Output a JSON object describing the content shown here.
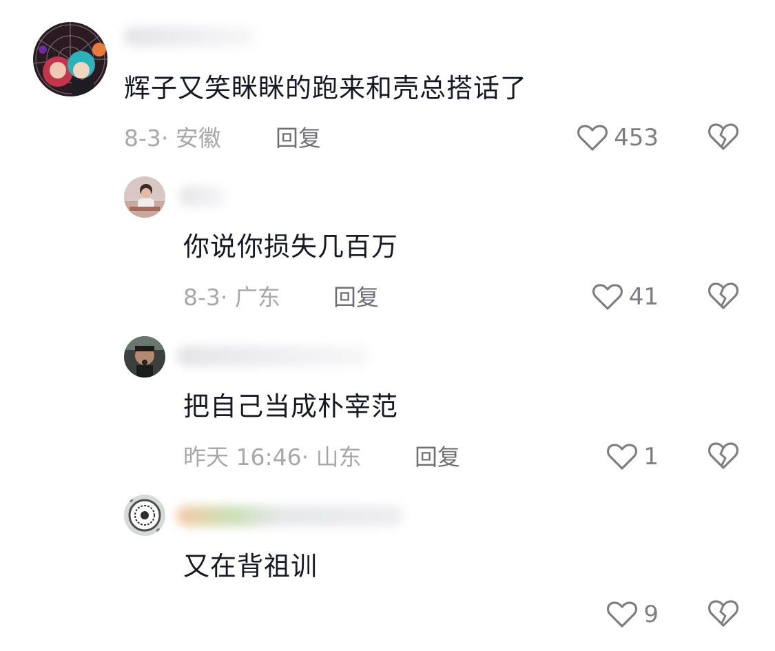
{
  "comments": [
    {
      "text": "辉子又笑眯眯的跑来和壳总搭话了",
      "meta": "8-3· 安徽",
      "reply_label": "回复",
      "likes": "453"
    },
    {
      "text": "你说你损失几百万",
      "meta": "8-3· 广东",
      "reply_label": "回复",
      "likes": "41"
    },
    {
      "text": "把自己当成朴宰范",
      "meta": "昨天 16:46· 山东",
      "reply_label": "回复",
      "likes": "1"
    },
    {
      "text": "又在背祖训",
      "likes": "9"
    }
  ],
  "icons": {
    "like": "heart-outline-icon",
    "dislike": "broken-heart-icon"
  },
  "colors": {
    "text": "#161823",
    "meta": "#a7a8ac",
    "reply": "#6f7076",
    "icon": "#7d7e84"
  }
}
